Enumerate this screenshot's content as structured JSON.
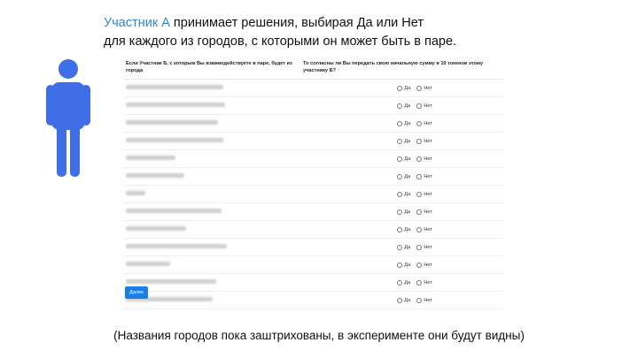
{
  "intro": {
    "participant": "Участник А",
    "line1_rest": " принимает решения, выбирая Да или Нет",
    "line2": "для каждого из городов, с которыми он может быть в паре."
  },
  "survey": {
    "col_city_header": "Если Участник Б, с которым Вы взаимодействуете в паре, будет из города",
    "col_question_header": "То согласны ли Вы передать свою начальную сумму в 10 токенов этому участнику Б?",
    "yes_label": "Да",
    "no_label": "Нет",
    "row_count": 13
  },
  "next_button": "Далее",
  "footnote": "(Названия городов пока заштрихованы, в эксперименте они будут видны)",
  "colors": {
    "accent": "#1a7ee8",
    "participant_text": "#2f86d6",
    "person_icon": "#3f6ee6"
  },
  "icons": {
    "person": "person-icon"
  }
}
